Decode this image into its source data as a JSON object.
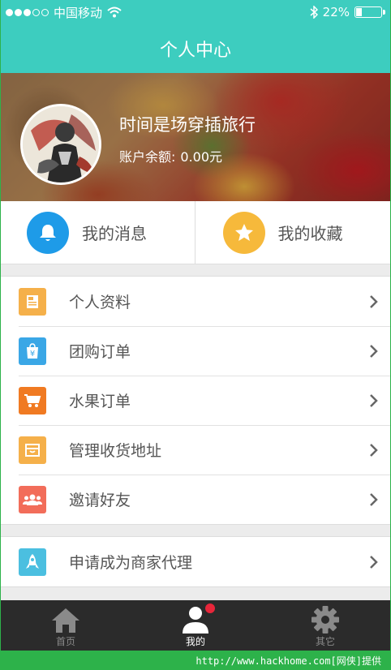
{
  "status": {
    "carrier": "中国移动",
    "battery": "22%",
    "battery_level": 0.22
  },
  "header": {
    "title": "个人中心"
  },
  "profile": {
    "name": "时间是场穿插旅行",
    "balance_label": "账户余额:",
    "balance_value": "0.00元"
  },
  "quick_actions": [
    {
      "label": "我的消息",
      "icon": "bell-icon",
      "color": "#1e9be8"
    },
    {
      "label": "我的收藏",
      "icon": "star-icon",
      "color": "#f6b93b"
    }
  ],
  "menu_group_1": [
    {
      "label": "个人资料",
      "icon": "profile-card-icon",
      "color": "#f5b04a"
    },
    {
      "label": "团购订单",
      "icon": "yen-bag-icon",
      "color": "#3aa7e6"
    },
    {
      "label": "水果订单",
      "icon": "cart-icon",
      "color": "#f07a22"
    },
    {
      "label": "管理收货地址",
      "icon": "box-icon",
      "color": "#f5b04a"
    },
    {
      "label": "邀请好友",
      "icon": "people-icon",
      "color": "#f26d5a"
    }
  ],
  "menu_group_2": [
    {
      "label": "申请成为商家代理",
      "icon": "rocket-icon",
      "color": "#4bbfe0"
    }
  ],
  "tabs": [
    {
      "label": "首页",
      "icon": "home-icon",
      "active": false
    },
    {
      "label": "我的",
      "icon": "user-icon",
      "active": true
    },
    {
      "label": "其它",
      "icon": "gear-icon",
      "active": false
    }
  ],
  "watermark": "http://www.hackhome.com[网侠]提供"
}
